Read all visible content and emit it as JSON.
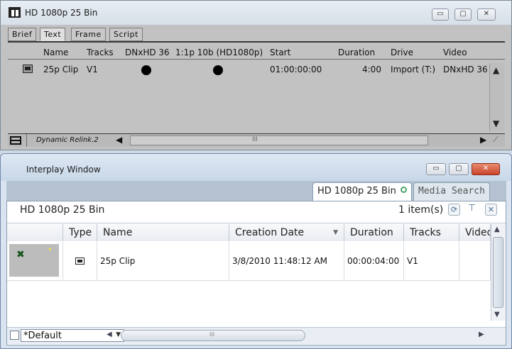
{
  "bin_window": {
    "title": "HD 1080p 25 Bin",
    "tabs": [
      "Brief",
      "Text",
      "Frame",
      "Script"
    ],
    "active_tab": "Text",
    "columns": [
      "Name",
      "Tracks",
      "DNxHD 36",
      "1:1p 10b (HD1080p)",
      "Start",
      "Duration",
      "Drive",
      "Video"
    ],
    "row": {
      "name": "25p Clip",
      "tracks": "V1",
      "start": "01:00:00:00",
      "duration": "4:00",
      "drive": "Import (T:)",
      "video": "DNxHD 36"
    },
    "status": {
      "label": "Dynamic Relink.2",
      "scroll_mark": "III"
    },
    "controls": {
      "minimize": "▭",
      "maximize": "▢",
      "close": "✕"
    }
  },
  "interplay_window": {
    "title": "Interplay Window",
    "tabs": [
      {
        "label": "HD 1080p 25 Bin",
        "active": true
      },
      {
        "label": "Media Search",
        "active": false
      }
    ],
    "bin_name": "HD 1080p 25 Bin",
    "item_count": "1 item(s)",
    "columns": [
      "Type",
      "Name",
      "Creation Date",
      "Duration",
      "Tracks",
      "Video"
    ],
    "row": {
      "name": "25p Clip",
      "creation_date": "3/8/2010 11:48:12 AM",
      "duration": "00:00:04:00",
      "tracks": "V1",
      "video": ""
    },
    "view_select": "*Default",
    "scroll_mark": "III",
    "accent_colors": {
      "close": "#c9452d",
      "title_bg": "#d3e0ee"
    }
  }
}
